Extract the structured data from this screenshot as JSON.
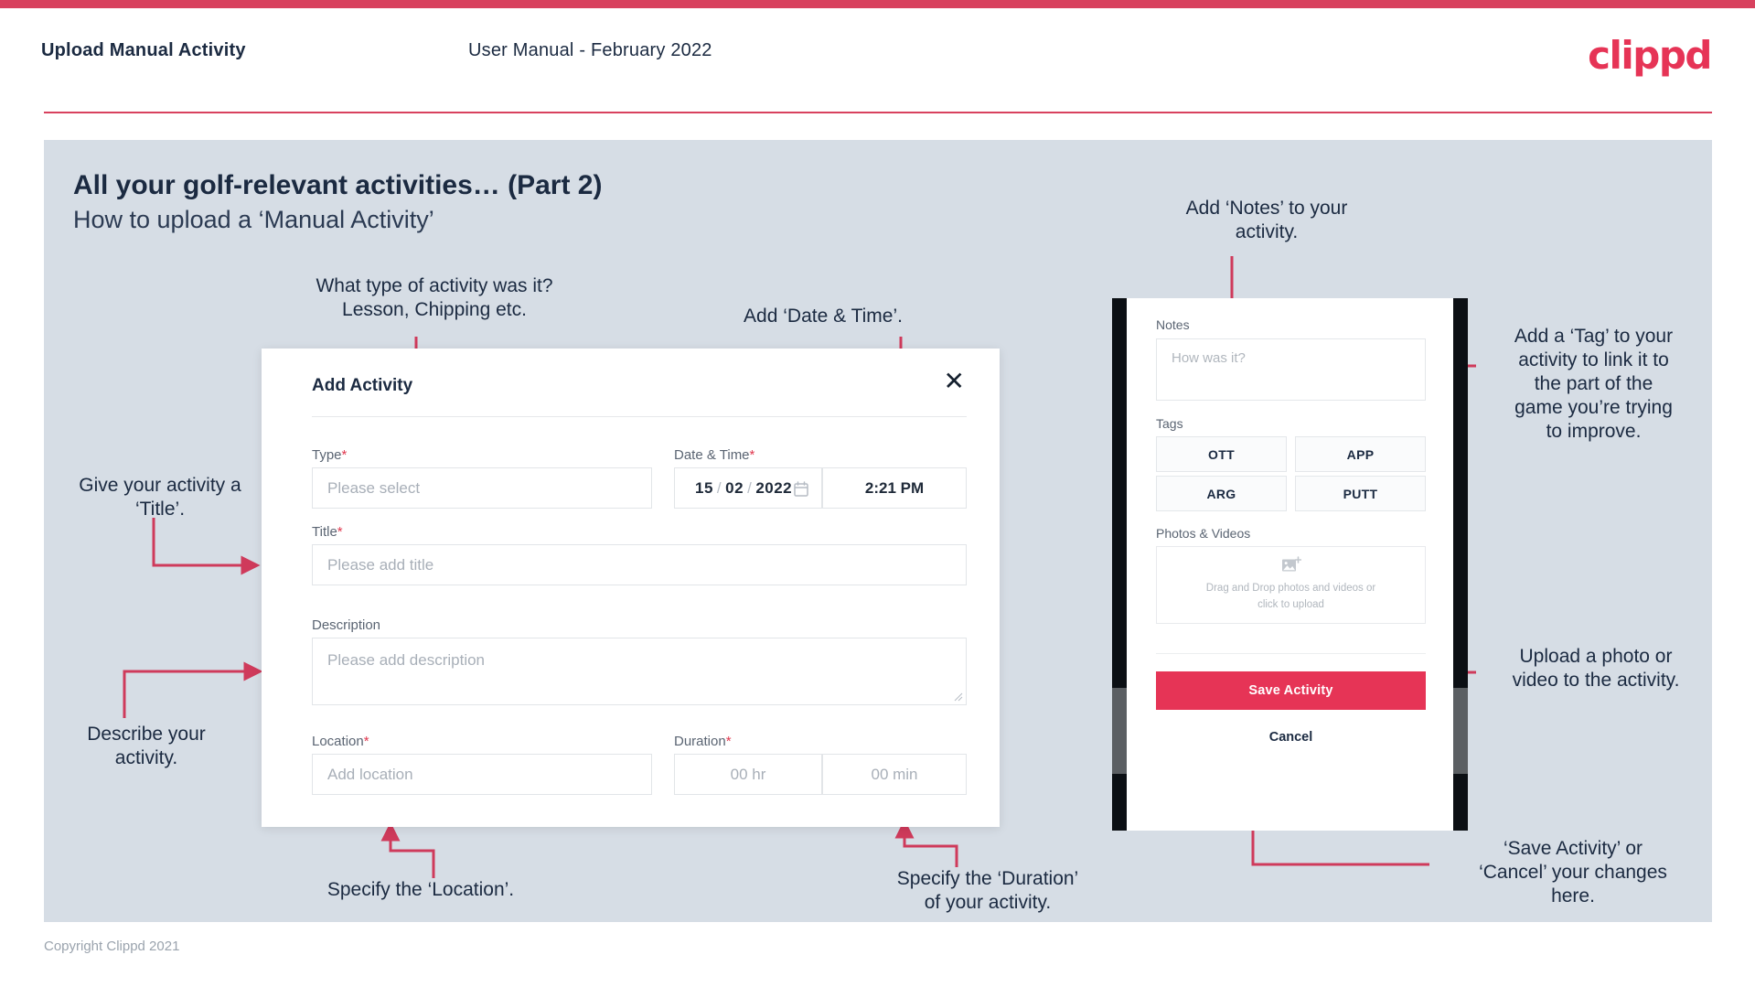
{
  "header": {
    "title": "Upload Manual Activity",
    "subtitle": "User Manual - February 2022",
    "logo": "clippd"
  },
  "slide": {
    "heading": "All your golf-relevant activities… (Part 2)",
    "subheading": "How to upload a ‘Manual Activity’"
  },
  "footer": {
    "copyright": "Copyright Clippd 2021"
  },
  "dialog": {
    "title": "Add Activity",
    "close_icon": "✕",
    "fields": {
      "type": {
        "label": "Type",
        "required": "*",
        "placeholder": "Please select"
      },
      "datetime": {
        "label": "Date & Time",
        "required": "*",
        "day": "15",
        "month": "02",
        "year": "2022",
        "sep": "/",
        "time": "2:21 PM"
      },
      "title": {
        "label": "Title",
        "required": "*",
        "placeholder": "Please add title"
      },
      "description": {
        "label": "Description",
        "required": "",
        "placeholder": "Please add description"
      },
      "location": {
        "label": "Location",
        "required": "*",
        "placeholder": "Add location"
      },
      "duration": {
        "label": "Duration",
        "required": "*",
        "hours": "00 hr",
        "minutes": "00 min"
      }
    }
  },
  "phone": {
    "notes": {
      "label": "Notes",
      "placeholder": "How was it?"
    },
    "tags": {
      "label": "Tags",
      "items": [
        "OTT",
        "APP",
        "ARG",
        "PUTT"
      ]
    },
    "photos": {
      "label": "Photos & Videos",
      "drop_line1": "Drag and Drop photos and videos or",
      "drop_line2": "click to upload"
    },
    "save_label": "Save Activity",
    "cancel_label": "Cancel"
  },
  "annotations": {
    "type": "What type of activity was it?\nLesson, Chipping etc.",
    "datetime": "Add ‘Date & Time’.",
    "title": "Give your activity a\n‘Title’.",
    "description": "Describe your\nactivity.",
    "location": "Specify the ‘Location’.",
    "duration": "Specify the ‘Duration’\nof your activity.",
    "notes": "Add ‘Notes’ to your\nactivity.",
    "tags": "Add a ‘Tag’ to your\nactivity to link it to\nthe part of the\ngame you’re trying\nto improve.",
    "upload": "Upload a photo or\nvideo to the activity.",
    "save": "‘Save Activity’ or\n‘Cancel’ your changes\nhere."
  },
  "colors": {
    "brand": "#e63456",
    "accent": "#d8415e",
    "slide_bg": "#d6dde5",
    "ink": "#1b2a41"
  }
}
